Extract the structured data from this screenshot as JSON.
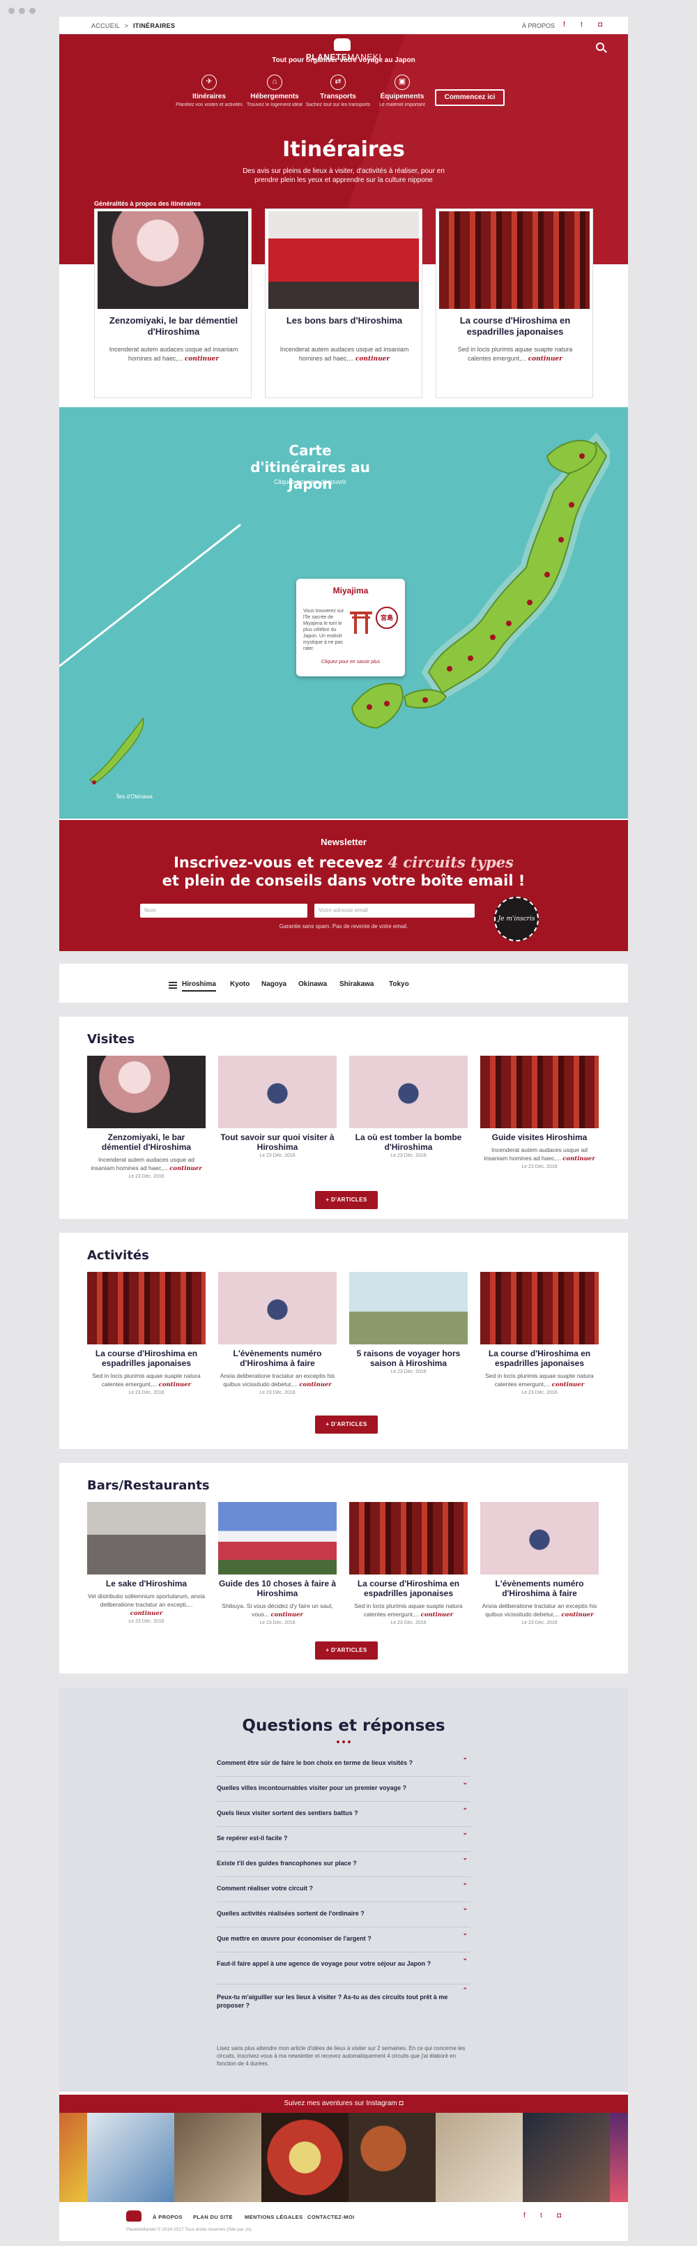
{
  "breadcrumb": {
    "home": "ACCUEIL",
    "sep": ">",
    "current": "ITINÉRAIRES"
  },
  "topbar": {
    "apropos": "À PROPOS",
    "icons": [
      "facebook-icon",
      "twitter-icon",
      "instagram-icon"
    ]
  },
  "brand": {
    "name_bold": "PLANETE",
    "name_light": "MANEKI",
    "tagline": "Tout pour organiser votre voyage au Japon"
  },
  "nav": [
    {
      "title": "Itinéraires",
      "sub": "Planifiez vos visites et activités"
    },
    {
      "title": "Hébergements",
      "sub": "Trouvez le logement idéal"
    },
    {
      "title": "Transports",
      "sub": "Sachez tout sur les transports"
    },
    {
      "title": "Équipements",
      "sub": "Le matériel important"
    }
  ],
  "cta": "Commencez ici",
  "hero": {
    "title": "Itinéraires",
    "intro": "Des avis sur pleins de lieux à visiter, d'activités à réaliser, pour en prendre plein les yeux et apprendre sur la culture nippone",
    "general": "Généralités à propos des itinéraires"
  },
  "featured": [
    {
      "title": "Zenzomiyaki, le bar démentiel d'Hiroshima",
      "excerpt": "Incenderat autem audaces usque ad insaniam homines ad haec,...",
      "more": "continuer"
    },
    {
      "title": "Les bons bars d'Hiroshima",
      "excerpt": "Incenderat autem audaces usque ad insaniam homines ad haec,...",
      "more": "continuer"
    },
    {
      "title": "La course d'Hiroshima en espadrilles japonaises",
      "excerpt": "Sed in locis plurimis aquae suapte natura calentes emergunt,...",
      "more": "continuer"
    }
  ],
  "map": {
    "title": "Carte d'itinéraires au Japon",
    "subtitle": "Cliquez pour les découvrir",
    "popup_title": "Miyajima",
    "popup_text": "Vous trouverez sur l'île sacrée de Miyajima le torii le plus célèbre du Japon. Un endroit mystique à ne pas rater.",
    "popup_stamp": "宮島",
    "popup_link": "Cliquez pour en savoir plus",
    "island_label": "Îles d'Okinawa"
  },
  "newsletter": {
    "label": "Newsletter",
    "headline_1": "Inscrivez-vous et recevez",
    "headline_hl": "4 circuits types",
    "headline_2": "et plein de conseils dans votre boîte email !",
    "name_placeholder": "Nom",
    "email_placeholder": "Votre adresse email",
    "button": "Je m'inscris",
    "guarantee": "Garantie sans spam. Pas de revente de votre email."
  },
  "cities": [
    "Hiroshima",
    "Kyoto",
    "Nagoya",
    "Okinawa",
    "Shirakawa",
    "Tokyo"
  ],
  "sections": [
    {
      "title": "Visites",
      "button": "+ D'ARTICLES",
      "tiles": [
        {
          "title": "Zenzomiyaki, le bar démentiel d'Hiroshima",
          "excerpt": "Incenderat autem audaces usque ad insaniam homines ad haec,...",
          "more": "continuer",
          "date": "Le 23 Déc. 2016"
        },
        {
          "title": "Tout savoir sur quoi visiter à Hiroshima",
          "excerpt": "",
          "more": "",
          "date": "Le 23 Déc. 2016"
        },
        {
          "title": "La où est tomber la bombe d'Hiroshima",
          "excerpt": "",
          "more": "",
          "date": "Le 23 Déc. 2016"
        },
        {
          "title": "Guide visites Hiroshima",
          "excerpt": "Incenderat autem audaces usque ad insaniam homines ad haec,...",
          "more": "continuer",
          "date": "Le 23 Déc. 2016"
        }
      ]
    },
    {
      "title": "Activités",
      "button": "+ D'ARTICLES",
      "tiles": [
        {
          "title": "La course d'Hiroshima en espadrilles japonaises",
          "excerpt": "Sed in locis plurimis aquae suapte natura calentes emergunt,...",
          "more": "continuer",
          "date": "Le 23 Déc. 2016"
        },
        {
          "title": "L'évènements numéro d'Hiroshima à faire",
          "excerpt": "Anxia deliberatione tractatur an exceptis his quibus vicissitudo debetur,...",
          "more": "continuer",
          "date": "Le 23 Déc. 2016"
        },
        {
          "title": "5 raisons de voyager hors saison à Hiroshima",
          "excerpt": "",
          "more": "",
          "date": "Le 23 Déc. 2016"
        },
        {
          "title": "La course d'Hiroshima en espadrilles japonaises",
          "excerpt": "Sed in locis plurimis aquae suapte natura calentes emergunt,...",
          "more": "continuer",
          "date": "Le 23 Déc. 2016"
        }
      ]
    },
    {
      "title": "Bars/Restaurants",
      "button": "+ D'ARTICLES",
      "tiles": [
        {
          "title": "Le sake d'Hiroshima",
          "excerpt": "Vel distributio sollemnium sportularum, anxia deliberatione tractatur an excepti,...",
          "more": "continuer",
          "date": "Le 23 Déc. 2016"
        },
        {
          "title": "Guide des 10 choses à faire à Hiroshima",
          "excerpt": "Shibuya. Si vous décidez d'y faire un saut, vous...",
          "more": "continuer",
          "date": "Le 23 Déc. 2016"
        },
        {
          "title": "La course d'Hiroshima en espadrilles japonaises",
          "excerpt": "Sed in locis plurimis aquae suapte natura calentes emergunt,...",
          "more": "continuer",
          "date": "Le 23 Déc. 2016"
        },
        {
          "title": "L'évènements numéro d'Hiroshima à faire",
          "excerpt": "Anxia deliberatione tractatur an exceptis his quibus vicissitudo debetur,...",
          "more": "continuer",
          "date": "Le 23 Déc. 2016"
        }
      ]
    }
  ],
  "faq": {
    "title": "Questions et réponses",
    "questions": [
      "Comment être sûr de faire le bon choix en terme de lieux visités ?",
      "Quelles villes incontournables visiter pour un premier voyage ?",
      "Quels lieux visiter sortent des sentiers battus ?",
      "Se repérer est-il facile ?",
      "Existe t'il des guides francophones sur place ?",
      "Comment réaliser votre circuit ?",
      "Quelles activités réalisées sortent de l'ordinaire ?",
      "Que mettre en œuvre pour économiser de l'argent ?",
      "Faut-il faire appel à une agence de voyage pour votre séjour au Japon ?",
      "Peux-tu m'aiguiller sur les lieux à visiter ? As-tu as des circuits tout prêt à me proposer ?"
    ],
    "answer": "Lisez sans plus attendre mon article d'idées de lieux à visiter sur 2 semaines. En ce qui concerne les circuits, inscrivez-vous à ma newsletter et recevez automatiquement 4 circuits que j'ai élaboré en fonction de 4 durées."
  },
  "instagram": {
    "label": "Suivez mes aventures sur Instagram"
  },
  "footer": {
    "links": [
      "À PROPOS",
      "PLAN DU SITE",
      "MENTIONS LÉGALES",
      "CONTACTEZ-MOI"
    ],
    "copyright": "PlaneteManeki © 2014-2017 Tous droits réservés (Site par Jo)."
  },
  "colors": {
    "brand_red": "#a31422",
    "map_teal": "#5fc0c0",
    "faq_bg": "#dde1e6",
    "navy": "#1f1f3a"
  }
}
